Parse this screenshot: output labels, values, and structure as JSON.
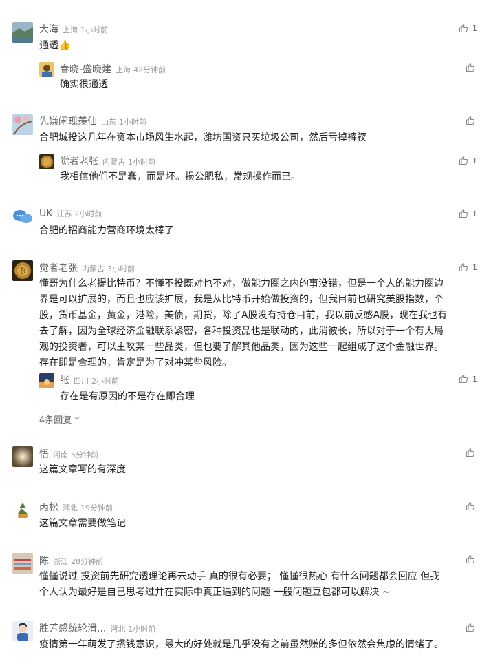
{
  "comments": [
    {
      "name": "大海",
      "location": "上海",
      "time": "1小时前",
      "text": "通透👍",
      "likes": "1"
    },
    {
      "name": "春晓-盛晓建",
      "location": "上海",
      "time": "42分钟前",
      "text": "确实很通透",
      "likes": ""
    },
    {
      "name": "先嫌闲现羡仙",
      "location": "山东",
      "time": "1小时前",
      "text": "合肥城投这几年在资本市场风生水起，潍坊国资只买垃圾公司，然后亏掉裤衩",
      "likes": ""
    },
    {
      "name": "觉者老张",
      "location": "内蒙古",
      "time": "1小时前",
      "text": "我相信他们不是蠢，而是坏。损公肥私，常规操作而已。",
      "likes": "1"
    },
    {
      "name": "UK",
      "location": "江苏",
      "time": "2小时前",
      "text": "合肥的招商能力营商环境太棒了",
      "likes": "1"
    },
    {
      "name": "觉者老张",
      "location": "内蒙古",
      "time": "3小时前",
      "text_lines": [
        "懂哥为什么老提比特币？不懂不投既对也不对，做能力圈之内的事没错，但是一个人的能力圈边",
        "界是可以扩展的，而且也应该扩展，我是从比特币开始做投资的，但我目前也研究美股指数，个",
        "股，货币基金，黄金，港险，美债，期货，除了A股没有持仓目前，我以前反感A股，现在我也有",
        "去了解，因为全球经济金融联系紧密，各种投资品也是联动的，此消彼长，所以对于一个有大局",
        "观的投资者，可以主攻某一些品类，但也要了解其他品类，因为这些一起组成了这个金融世界。",
        "存在即是合理的，肯定是为了对冲某些风险。"
      ],
      "likes": "1"
    },
    {
      "name": "张",
      "location": "四川",
      "time": "2小时前",
      "text": "存在是有原因的不是存在即合理",
      "likes": "1"
    },
    {
      "name": "悟",
      "location": "河南",
      "time": "5分钟前",
      "text": "这篇文章写的有深度",
      "likes": ""
    },
    {
      "name": "丙松",
      "location": "湖北",
      "time": "19分钟前",
      "text": "这篇文章需要做笔记",
      "likes": ""
    },
    {
      "name": "陈",
      "location": "浙江",
      "time": "28分钟前",
      "text_lines": [
        "懂懂说过 投资前先研究透理论再去动手 真的很有必要；  懂懂很热心 有什么问题都会回应 但我",
        "个人认为最好是自己思考过并在实际中真正遇到的问题 一般问题豆包都可以解决 ~"
      ],
      "likes": ""
    },
    {
      "name": "胜芳感统轮滑...",
      "location": "河北",
      "time": "1小时前",
      "text": "疫情第一年萌发了攒钱意识，最大的好处就是几乎没有之前虽然赚的多但依然会焦虑的情绪了。",
      "likes": ""
    }
  ],
  "more_replies": "4条回复",
  "more_replies_chevron": "chevron-down-icon",
  "like_icon": "thumbs-up-icon",
  "colors": {
    "name": "#666666",
    "meta": "#9a9a9a",
    "text": "#222222",
    "icon": "#888888"
  }
}
